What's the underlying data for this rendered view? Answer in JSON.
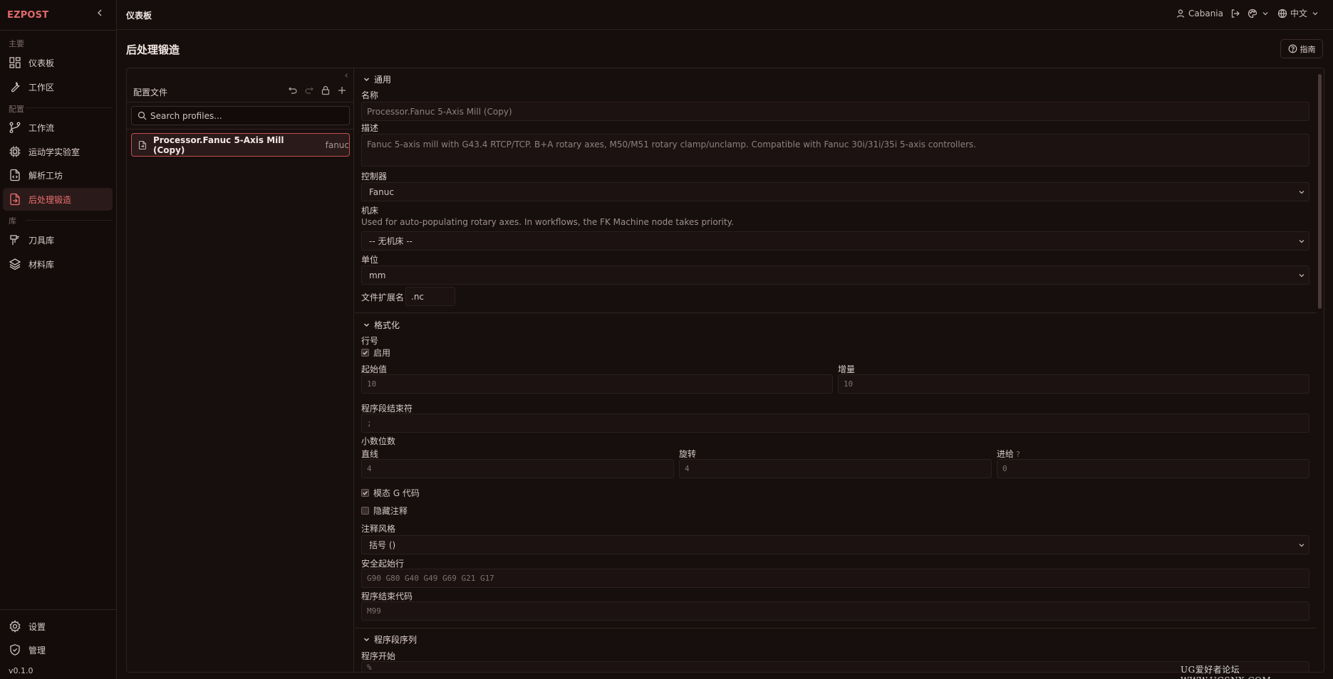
{
  "app": {
    "brand": "EZPOST",
    "version": "v0.1.0"
  },
  "sidebar": {
    "sections": [
      "主要",
      "配置",
      "库"
    ],
    "items": [
      {
        "label": "仪表板",
        "icon": "dashboard-icon"
      },
      {
        "label": "工作区",
        "icon": "wrench-icon"
      },
      {
        "label": "工作流",
        "icon": "workflow-icon"
      },
      {
        "label": "运动学实验室",
        "icon": "cpu-icon"
      },
      {
        "label": "解析工坊",
        "icon": "file-code-icon"
      },
      {
        "label": "后处理锻造",
        "icon": "file-export-icon"
      },
      {
        "label": "刀具库",
        "icon": "tool-icon"
      },
      {
        "label": "材料库",
        "icon": "layers-icon"
      }
    ],
    "bottom": [
      {
        "label": "设置",
        "icon": "gear-icon"
      },
      {
        "label": "管理",
        "icon": "shield-icon"
      }
    ]
  },
  "topbar": {
    "title": "仪表板",
    "user": "Cabania",
    "language": "中文"
  },
  "page": {
    "title": "后处理锻造",
    "guide_label": "指南"
  },
  "profiles": {
    "label": "配置文件",
    "search_placeholder": "Search profiles...",
    "items": [
      {
        "name": "Processor.Fanuc 5-Axis Mill (Copy)",
        "tag": "fanuc"
      }
    ]
  },
  "form": {
    "general": {
      "title": "通用",
      "name_label": "名称",
      "name_value": "Processor.Fanuc 5-Axis Mill (Copy)",
      "desc_label": "描述",
      "desc_value": "Fanuc 5-axis mill with G43.4 RTCP/TCP. B+A rotary axes, M50/M51 rotary clamp/unclamp. Compatible with Fanuc 30i/31i/35i 5-axis controllers.",
      "controller_label": "控制器",
      "controller_value": "Fanuc",
      "machine_label": "机床",
      "machine_hint": "Used for auto-populating rotary axes. In workflows, the FK Machine node takes priority.",
      "machine_value": "-- 无机床 --",
      "units_label": "单位",
      "units_value": "mm",
      "ext_label": "文件扩展名",
      "ext_value": ".nc"
    },
    "format": {
      "title": "格式化",
      "line_numbers_label": "行号",
      "enable_label": "启用",
      "start_label": "起始值",
      "start_value": "10",
      "increment_label": "增量",
      "increment_value": "10",
      "eob_label": "程序段结束符",
      "eob_value": ";",
      "decimals_label": "小数位数",
      "linear_label": "直线",
      "linear_value": "4",
      "rotary_label": "旋转",
      "rotary_value": "4",
      "feed_label": "进给",
      "feed_help": "?",
      "feed_value": "0",
      "modal_label": "模态 G 代码",
      "hide_comments_label": "隐藏注释",
      "comment_style_label": "注释风格",
      "comment_style_value": "括号 ()",
      "safe_start_label": "安全起始行",
      "safe_start_value": "G90 G80 G40 G49 G69 G21 G17",
      "end_code_label": "程序结束代码",
      "end_code_value": "M99"
    },
    "sequence": {
      "title": "程序段序列",
      "program_start_label": "程序开始",
      "program_start_value": "%"
    }
  },
  "watermark": "UG爱好者论坛 WWW.UGSNX.COM"
}
